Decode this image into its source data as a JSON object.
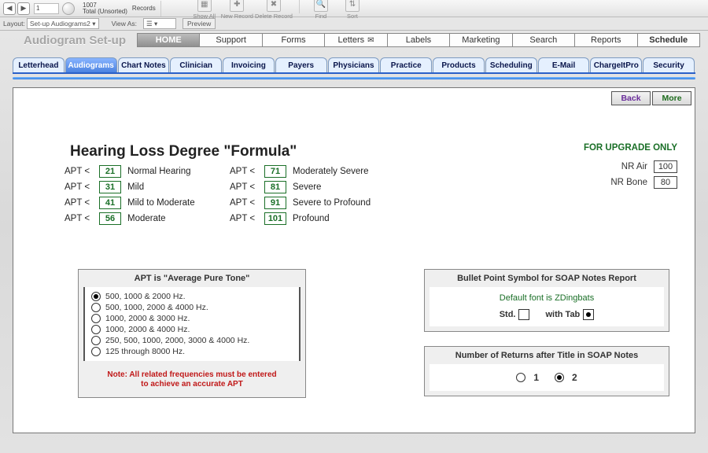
{
  "records": {
    "current": "1",
    "total": "1007",
    "status": "Total (Unsorted)",
    "label": "Records"
  },
  "toolbar": {
    "show_all": "Show All",
    "new_record": "New Record",
    "delete_record": "Delete Record",
    "find": "Find",
    "sort": "Sort"
  },
  "layout_row": {
    "layout_label": "Layout:",
    "layout_value": "Set-up Audiograms2",
    "viewas_label": "View As:",
    "preview": "Preview"
  },
  "page_title": "Audiogram Set-up",
  "top_nav": [
    "HOME",
    "Support",
    "Forms",
    "Letters",
    "Labels",
    "Marketing",
    "Search",
    "Reports",
    "Schedule"
  ],
  "sub_tabs": [
    "Letterhead",
    "Audiograms",
    "Chart Notes",
    "Clinician",
    "Invoicing",
    "Payers",
    "Physicians",
    "Practice",
    "Products",
    "Scheduling",
    "E-Mail",
    "ChargeItPro",
    "Security"
  ],
  "active_sub_tab_index": 1,
  "corner": {
    "back": "Back",
    "more": "More"
  },
  "formula_heading": "Hearing Loss Degree \"Formula\"",
  "apt_prefix": "APT <",
  "apt_rows_left": [
    {
      "value": "21",
      "desc": "Normal Hearing"
    },
    {
      "value": "31",
      "desc": "Mild"
    },
    {
      "value": "41",
      "desc": "Mild to Moderate"
    },
    {
      "value": "56",
      "desc": "Moderate"
    }
  ],
  "apt_rows_right": [
    {
      "value": "71",
      "desc": "Moderately Severe"
    },
    {
      "value": "81",
      "desc": "Severe"
    },
    {
      "value": "91",
      "desc": "Severe to Profound"
    },
    {
      "value": "101",
      "desc": "Profound"
    }
  ],
  "upgrade": {
    "title": "FOR UPGRADE ONLY",
    "air_label": "NR Air",
    "air_value": "100",
    "bone_label": "NR Bone",
    "bone_value": "80"
  },
  "apt_box": {
    "title": "APT is \"Average Pure Tone\"",
    "options": [
      "500, 1000 & 2000 Hz.",
      "500, 1000, 2000 & 4000 Hz.",
      "1000, 2000 & 3000 Hz.",
      "1000, 2000 & 4000 Hz.",
      "250, 500, 1000, 2000, 3000 & 4000 Hz.",
      "125 through 8000 Hz."
    ],
    "selected_index": 0,
    "note1": "Note: All related frequencies must be entered",
    "note2": "to achieve an accurate APT"
  },
  "soap1": {
    "title": "Bullet Point Symbol for SOAP Notes Report",
    "default_font": "Default font is ZDingbats",
    "std_label": "Std.",
    "withtab_label": "with Tab"
  },
  "soap2": {
    "title": "Number of Returns after Title in SOAP Notes",
    "opt1": "1",
    "opt2": "2",
    "selected": 2
  }
}
